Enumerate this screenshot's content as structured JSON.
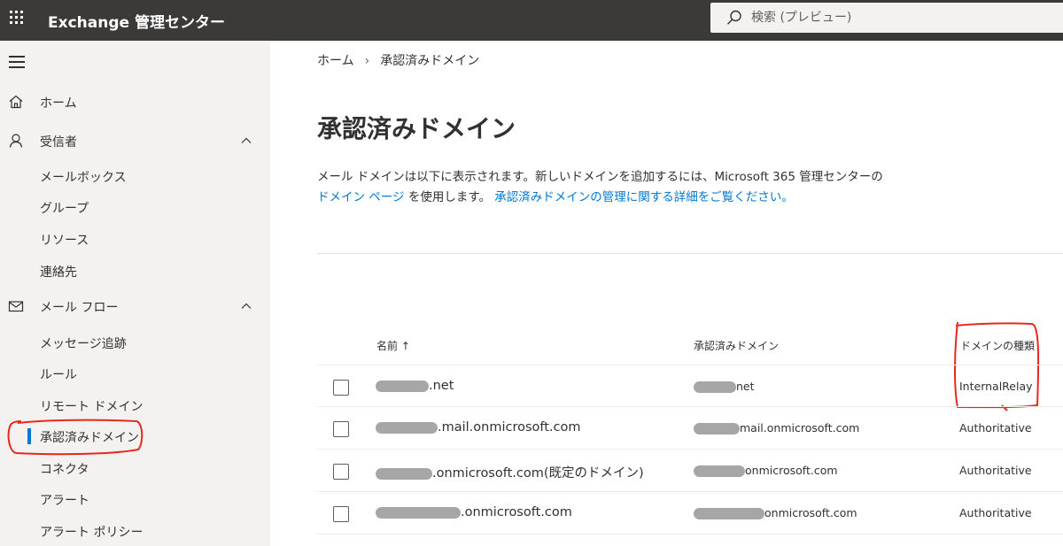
{
  "topbar": {
    "app_title": "Exchange 管理センター",
    "search_placeholder": "検索 (プレビュー)"
  },
  "sidebar": {
    "home": "ホーム",
    "recipients": "受信者",
    "recipients_items": [
      "メールボックス",
      "グループ",
      "リソース",
      "連絡先"
    ],
    "mailflow": "メール フロー",
    "mailflow_items": [
      "メッセージ追跡",
      "ルール",
      "リモート ドメイン",
      "承認済みドメイン",
      "コネクタ",
      "アラート",
      "アラート ポリシー"
    ]
  },
  "breadcrumb": {
    "home": "ホーム",
    "current": "承認済みドメイン"
  },
  "page_title": "承認済みドメイン",
  "description": {
    "text1": "メール ドメインは以下に表示されます。新しいドメインを追加するには、Microsoft 365 管理センターの",
    "link1": "ドメイン ページ",
    "text2": "を使用します。",
    "link2": "承認済みドメインの管理に関する詳細をご覧ください。"
  },
  "table": {
    "col_name": "名前 ↑",
    "col_domain": "承認済みドメイン",
    "col_type": "ドメインの種類",
    "rows": [
      {
        "name_suffix": ".net",
        "domain_suffix": "net",
        "type": "InternalRelay"
      },
      {
        "name_suffix": ".mail.onmicrosoft.com",
        "domain_suffix": "mail.onmicrosoft.com",
        "type": "Authoritative"
      },
      {
        "name_suffix": ".onmicrosoft.com(既定のドメイン)",
        "domain_suffix": "onmicrosoft.com",
        "type": "Authoritative"
      },
      {
        "name_suffix": ".onmicrosoft.com",
        "domain_suffix": "onmicrosoft.com",
        "type": "Authoritative"
      }
    ]
  },
  "colors": {
    "topbar": "#3b3a39",
    "sidebar": "#f3f2f1",
    "accent": "#0078d4",
    "annotation": "#e8281c"
  }
}
